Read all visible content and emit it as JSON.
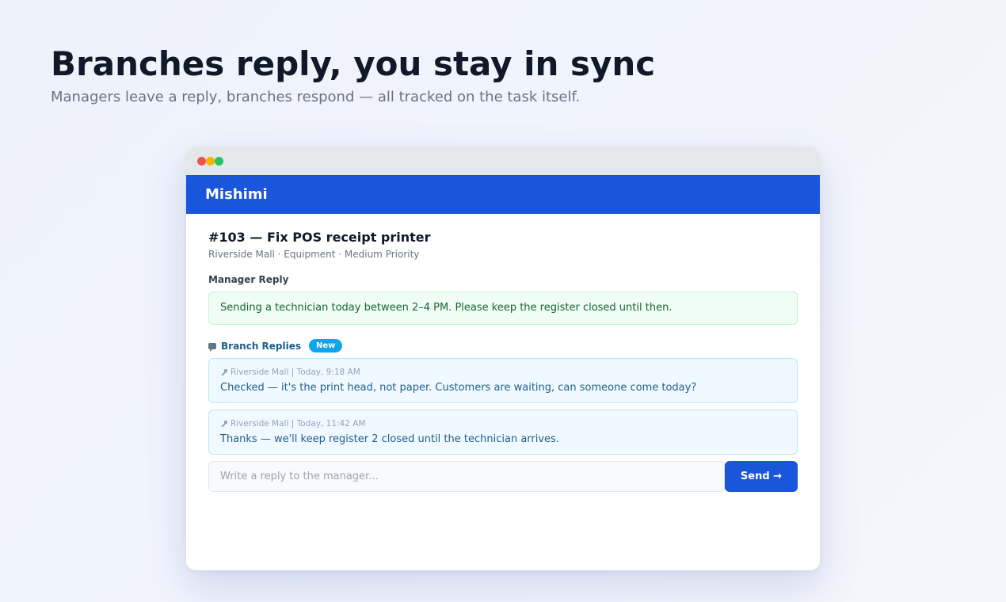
{
  "hero": {
    "title": "Branches reply, you stay in sync",
    "subtitle": "Managers leave a reply, branches respond — all tracked on the task itself."
  },
  "app": {
    "name": "Mishimi"
  },
  "task": {
    "title": "#103 — Fix POS receipt printer",
    "meta": "Riverside Mall · Equipment · Medium Priority"
  },
  "manager_reply": {
    "label": "Manager Reply",
    "text": "Sending a technician today between 2–4 PM. Please keep the register closed until then."
  },
  "branch_replies": {
    "label": "Branch Replies",
    "badge": "New",
    "items": [
      {
        "meta": "Riverside Mall | Today, 9:18 AM",
        "text": "Checked — it's the print head, not paper. Customers are waiting, can someone come today?"
      },
      {
        "meta": "Riverside Mall | Today, 11:42 AM",
        "text": "Thanks — we'll keep register 2 closed until the technician arrives."
      }
    ]
  },
  "compose": {
    "placeholder": "Write a reply to the manager...",
    "send_label": "Send →"
  },
  "colors": {
    "brand": "#1a56db",
    "badge": "#0ea5e9",
    "manager_bg": "#f0fdf4",
    "reply_bg": "#f0f9ff"
  },
  "icons": {
    "branch_replies": "speech-bubble-icon",
    "reply_meta": "pin-icon"
  }
}
